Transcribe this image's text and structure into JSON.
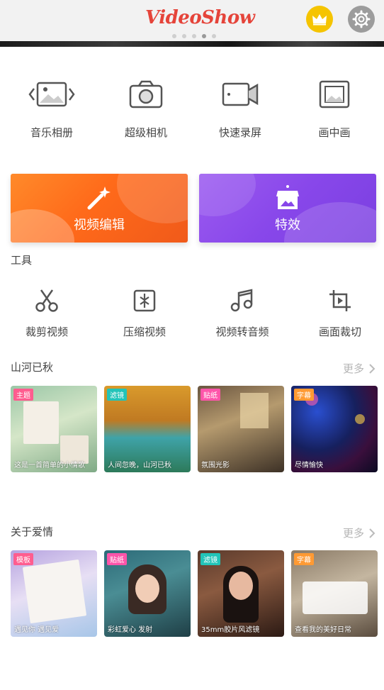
{
  "header": {
    "logo_text": "VideoShow",
    "dots_count": 5,
    "active_dot": 3
  },
  "features": [
    {
      "label": "音乐相册",
      "icon": "music-album-icon"
    },
    {
      "label": "超级相机",
      "icon": "camera-icon"
    },
    {
      "label": "快速录屏",
      "icon": "screen-record-icon"
    },
    {
      "label": "画中画",
      "icon": "picture-in-picture-icon"
    }
  ],
  "big_buttons": {
    "edit_label": "视频编辑",
    "effects_label": "特效"
  },
  "tools": {
    "title": "工具",
    "items": [
      {
        "label": "裁剪视频",
        "icon": "scissors-icon"
      },
      {
        "label": "压缩视频",
        "icon": "compress-icon"
      },
      {
        "label": "视频转音频",
        "icon": "music-note-icon"
      },
      {
        "label": "画面裁切",
        "icon": "crop-icon"
      }
    ]
  },
  "section1": {
    "title": "山河已秋",
    "more": "更多",
    "cards": [
      {
        "tag": "主题",
        "caption": "这是一首简单的小情歌"
      },
      {
        "tag": "滤镜",
        "caption": "人间忽晚，山河已秋"
      },
      {
        "tag": "贴纸",
        "caption": "氛围光影"
      },
      {
        "tag": "字幕",
        "caption": "尽情愉快"
      }
    ]
  },
  "section2": {
    "title": "关于爱情",
    "more": "更多",
    "cards": [
      {
        "tag": "模板",
        "caption": "遇见你 遇见爱"
      },
      {
        "tag": "贴纸",
        "caption": "彩虹爱心 发射"
      },
      {
        "tag": "滤镜",
        "caption": "35mm胶片风滤镜"
      },
      {
        "tag": "字幕",
        "caption": "查看我的美好日常"
      }
    ]
  },
  "colors": {
    "brand": "#e5443a",
    "edit": "#ff6a1a",
    "effects": "#8847ea",
    "vip": "#f5c400"
  }
}
